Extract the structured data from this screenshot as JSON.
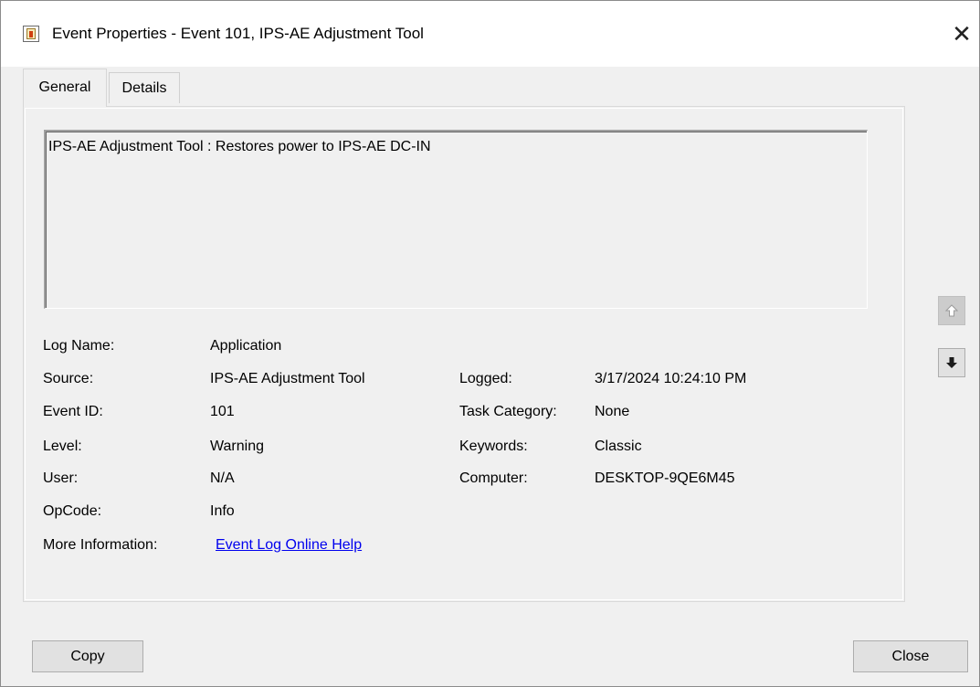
{
  "window": {
    "title": "Event Properties - Event 101, IPS-AE Adjustment Tool",
    "close_glyph": "✕"
  },
  "tabs": [
    {
      "label": "General",
      "active": true
    },
    {
      "label": "Details",
      "active": false
    }
  ],
  "description": "IPS-AE Adjustment Tool : Restores power to IPS-AE DC-IN",
  "fields": {
    "log_name": {
      "label": "Log Name:",
      "value": "Application"
    },
    "source": {
      "label": "Source:",
      "value": "IPS-AE Adjustment Tool"
    },
    "event_id": {
      "label": "Event ID:",
      "value": "101"
    },
    "level": {
      "label": "Level:",
      "value": "Warning"
    },
    "user": {
      "label": "User:",
      "value": "N/A"
    },
    "opcode": {
      "label": "OpCode:",
      "value": "Info"
    },
    "more_info": {
      "label": "More Information:",
      "value": "Event Log Online Help"
    },
    "logged": {
      "label": "Logged:",
      "value": "3/17/2024 10:24:10 PM"
    },
    "task_category": {
      "label": "Task Category:",
      "value": "None"
    },
    "keywords": {
      "label": "Keywords:",
      "value": "Classic"
    },
    "computer": {
      "label": "Computer:",
      "value": "DESKTOP-9QE6M45"
    }
  },
  "nav": {
    "up_icon": "arrow-up-icon",
    "down_icon": "arrow-down-icon",
    "up_enabled": false,
    "down_enabled": true
  },
  "buttons": {
    "copy": "Copy",
    "close": "Close"
  }
}
